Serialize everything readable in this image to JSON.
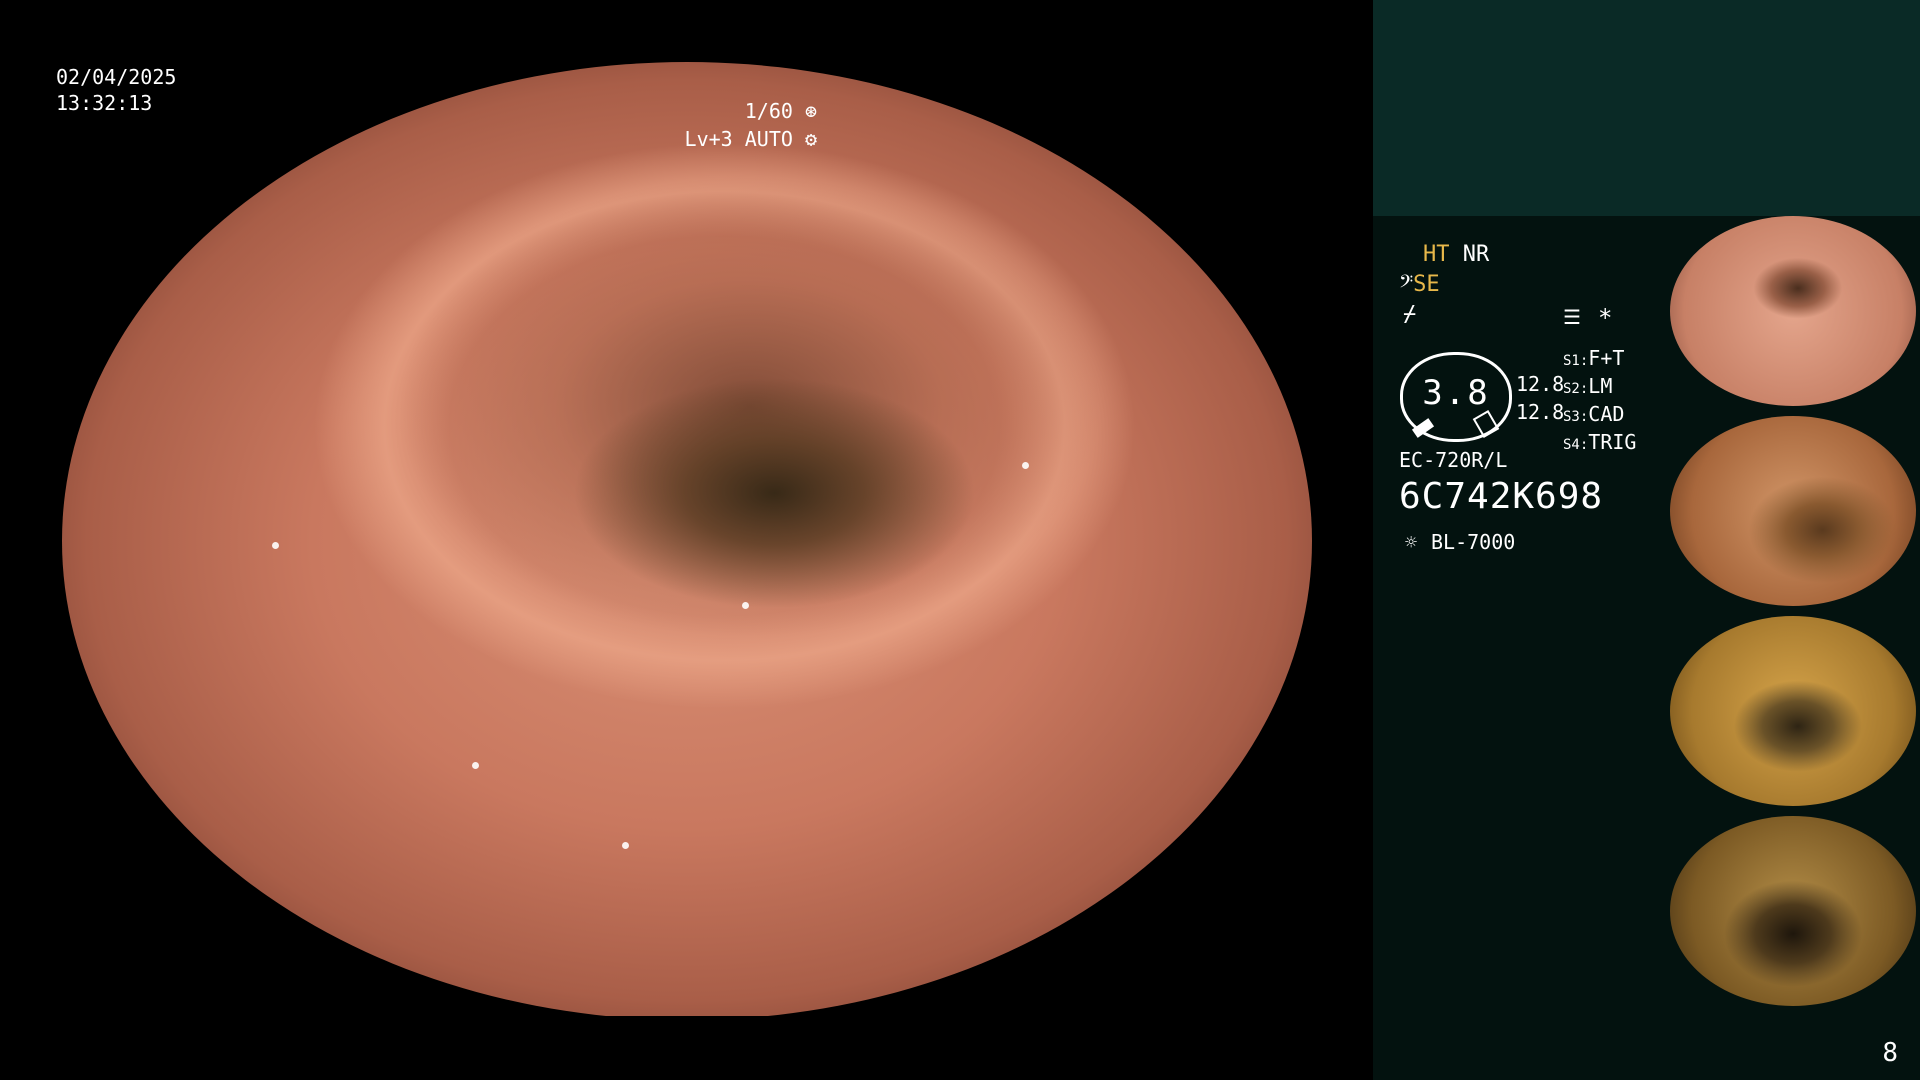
{
  "overlay": {
    "date": "02/04/2025",
    "time": "13:32:13",
    "shutter": "1/60",
    "shutter_icon": "⊛",
    "level_mode": "Lv+3 AUTO",
    "aperture_icon": "⚙"
  },
  "side_panel": {
    "mode": {
      "ht": "HT",
      "nr": "NR",
      "se": "SE",
      "se_icon": "𝄢",
      "third_icon": "⌿"
    },
    "menu_icon": "☰",
    "star": "*",
    "zoom_value": "3.8",
    "numbers": [
      "12.8",
      "12.8"
    ],
    "settings": [
      {
        "key": "S1:",
        "value": "F+T"
      },
      {
        "key": "S2:",
        "value": "LM"
      },
      {
        "key": "S3:",
        "value": "CAD"
      },
      {
        "key": "S4:",
        "value": "TRIG"
      }
    ],
    "scope_model": "EC-720R/L",
    "scope_serial": "6C742K698",
    "light_source_icon": "☼",
    "light_source": "BL-7000"
  },
  "page_number": "8",
  "colors": {
    "accent": "#e8b84a",
    "panel_bg": "#03120f",
    "panel_top_bg": "#0a2a26"
  }
}
